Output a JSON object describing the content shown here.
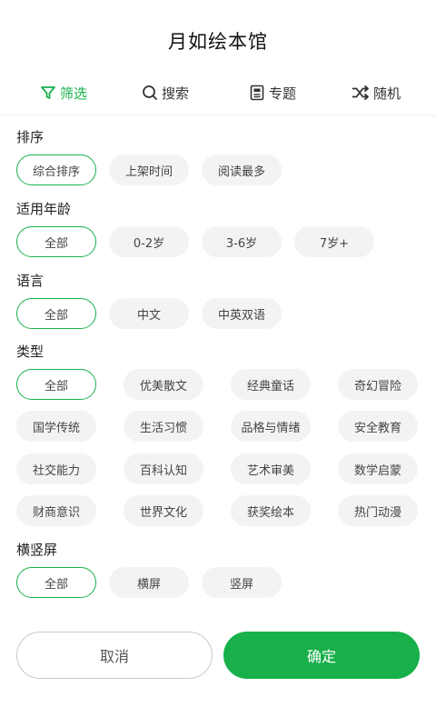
{
  "header": {
    "title": "月如绘本馆"
  },
  "tabs": [
    {
      "label": "筛选",
      "icon": "filter-icon",
      "active": true
    },
    {
      "label": "搜索",
      "icon": "search-icon",
      "active": false
    },
    {
      "label": "专题",
      "icon": "topic-icon",
      "active": false
    },
    {
      "label": "随机",
      "icon": "shuffle-icon",
      "active": false
    }
  ],
  "colors": {
    "accent": "#18b04a",
    "chip_bg": "#f3f3f3"
  },
  "sections": {
    "sort": {
      "title": "排序",
      "options": [
        "综合排序",
        "上架时间",
        "阅读最多"
      ],
      "selected": "综合排序"
    },
    "age": {
      "title": "适用年龄",
      "options": [
        "全部",
        "0-2岁",
        "3-6岁",
        "7岁+"
      ],
      "selected": "全部"
    },
    "language": {
      "title": "语言",
      "options": [
        "全部",
        "中文",
        "中英双语"
      ],
      "selected": "全部"
    },
    "type": {
      "title": "类型",
      "options": [
        "全部",
        "优美散文",
        "经典童话",
        "奇幻冒险",
        "国学传统",
        "生活习惯",
        "品格与情绪",
        "安全教育",
        "社交能力",
        "百科认知",
        "艺术审美",
        "数学启蒙",
        "财商意识",
        "世界文化",
        "获奖绘本",
        "热门动漫"
      ],
      "selected": "全部"
    },
    "orientation": {
      "title": "横竖屏",
      "options": [
        "全部",
        "横屏",
        "竖屏"
      ],
      "selected": "全部"
    }
  },
  "actions": {
    "cancel_label": "取消",
    "confirm_label": "确定"
  }
}
